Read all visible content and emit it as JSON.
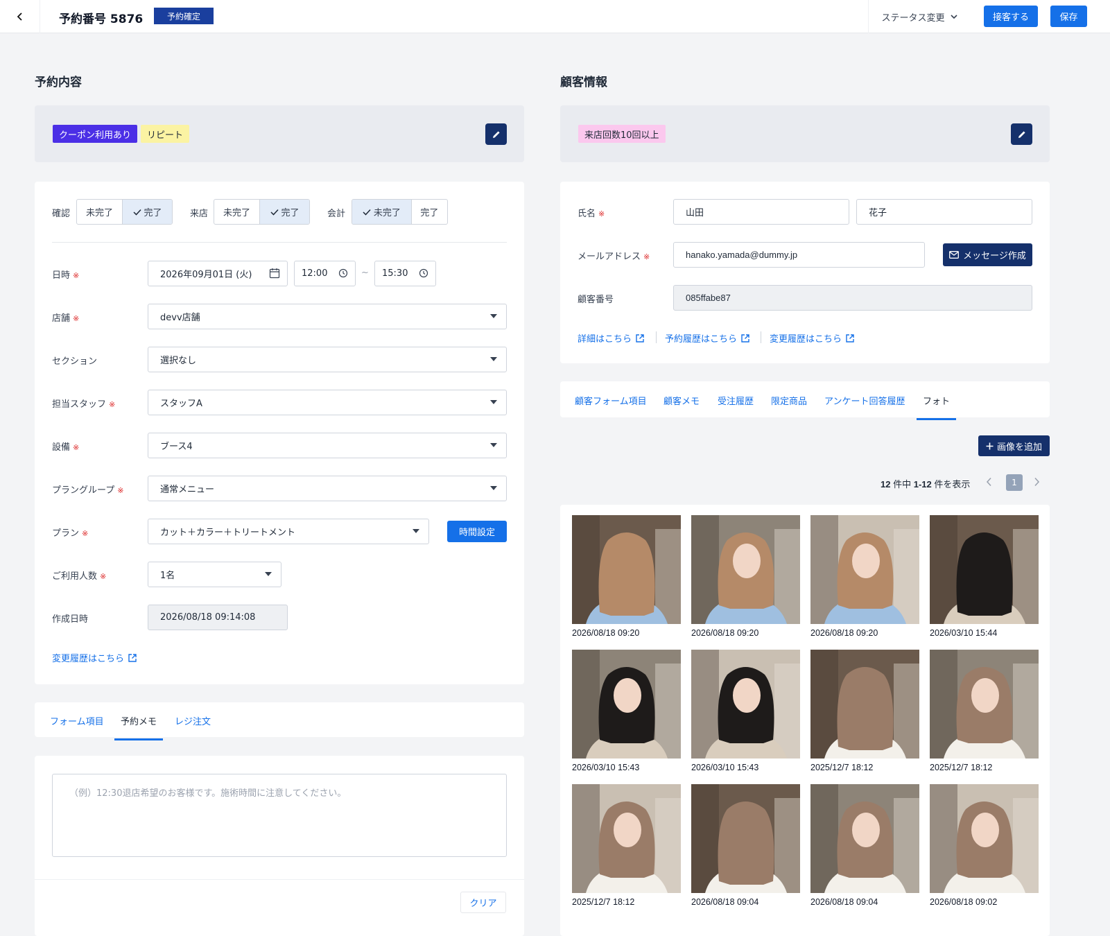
{
  "header": {
    "title": "予約番号 5876",
    "status": "予約確定",
    "status_change": "ステータス変更",
    "serve_button": "接客する",
    "save_button": "保存"
  },
  "reservation": {
    "section_title": "予約内容",
    "tags": [
      "クーポン利用あり",
      "リピート"
    ],
    "confirm": {
      "label": "確認",
      "options": [
        "未完了",
        "完了"
      ],
      "selected": "完了"
    },
    "visit": {
      "label": "来店",
      "options": [
        "未完了",
        "完了"
      ],
      "selected": "完了"
    },
    "payment": {
      "label": "会計",
      "options": [
        "未完了",
        "完了"
      ],
      "selected": "未完了"
    },
    "datetime": {
      "label": "日時",
      "date": "2026年09月01日 (火)",
      "start": "12:00",
      "separator": "~",
      "end": "15:30"
    },
    "store": {
      "label": "店舗",
      "value": "devv店舗"
    },
    "section": {
      "label": "セクション",
      "value": "選択なし"
    },
    "staff": {
      "label": "担当スタッフ",
      "value": "スタッフA"
    },
    "equipment": {
      "label": "設備",
      "value": "ブース4"
    },
    "plan_group": {
      "label": "プラングループ",
      "value": "通常メニュー"
    },
    "plan": {
      "label": "プラン",
      "value": "カット＋カラー＋トリートメント",
      "time_button": "時間設定"
    },
    "people": {
      "label": "ご利用人数",
      "value": "1名"
    },
    "created": {
      "label": "作成日時",
      "value": "2026/08/18 09:14:08"
    },
    "history_link": "変更履歴はこちら",
    "required_mark": "※"
  },
  "bottom_tabs": {
    "items": [
      "フォーム項目",
      "予約メモ",
      "レジ注文"
    ],
    "active": "予約メモ"
  },
  "memo": {
    "placeholder": "（例）12:30退店希望のお客様です。施術時間に注意してください。",
    "clear_button": "クリア"
  },
  "customer": {
    "section_title": "顧客情報",
    "tags": [
      "来店回数10回以上"
    ],
    "name": {
      "label": "氏名",
      "last": "山田",
      "first": "花子"
    },
    "email": {
      "label": "メールアドレス",
      "value": "hanako.yamada@dummy.jp",
      "message_button": "メッセージ作成"
    },
    "number": {
      "label": "顧客番号",
      "value": "085ffabe87"
    },
    "links": [
      "詳細はこちら",
      "予約履歴はこちら",
      "変更履歴はこちら"
    ]
  },
  "customer_tabs": {
    "items": [
      "顧客フォーム項目",
      "顧客メモ",
      "受注履歴",
      "限定商品",
      "アンケート回答履歴",
      "フォト"
    ],
    "active": "フォト"
  },
  "photos": {
    "add_button": "画像を追加",
    "pagination_count": "12",
    "pagination_text_1": "件中",
    "pagination_range": "1-12",
    "pagination_text_2": "件を表示",
    "current_page": "1",
    "items": [
      {
        "date": "2026/08/18 09:20",
        "hair": "light-brown",
        "view": "back"
      },
      {
        "date": "2026/08/18 09:20",
        "hair": "light-brown",
        "view": "front"
      },
      {
        "date": "2026/08/18 09:20",
        "hair": "light-brown",
        "view": "front"
      },
      {
        "date": "2026/03/10 15:44",
        "hair": "black",
        "view": "back"
      },
      {
        "date": "2026/03/10 15:43",
        "hair": "black",
        "view": "front"
      },
      {
        "date": "2026/03/10 15:43",
        "hair": "black",
        "view": "front"
      },
      {
        "date": "2025/12/7 18:12",
        "hair": "ash-brown",
        "view": "back"
      },
      {
        "date": "2025/12/7 18:12",
        "hair": "ash-brown",
        "view": "front"
      },
      {
        "date": "2025/12/7 18:12",
        "hair": "ash-brown",
        "view": "front"
      },
      {
        "date": "2026/08/18 09:04",
        "hair": "ash-brown",
        "view": "back"
      },
      {
        "date": "2026/08/18 09:04",
        "hair": "ash-brown",
        "view": "front"
      },
      {
        "date": "2026/08/18 09:02",
        "hair": "ash-brown",
        "view": "front"
      }
    ]
  },
  "colors": {
    "primary": "#1570e8",
    "navy": "#15306b",
    "status": "#1a3f9e",
    "coupon_tag": "#4b2fe6",
    "repeat_tag": "#fbf3a3",
    "visits_tag": "#fbc8ee",
    "required": "#dc2626",
    "hair_light_brown": "#b58a68",
    "hair_black": "#1e1b1a",
    "hair_ash_brown": "#9a7c68"
  }
}
